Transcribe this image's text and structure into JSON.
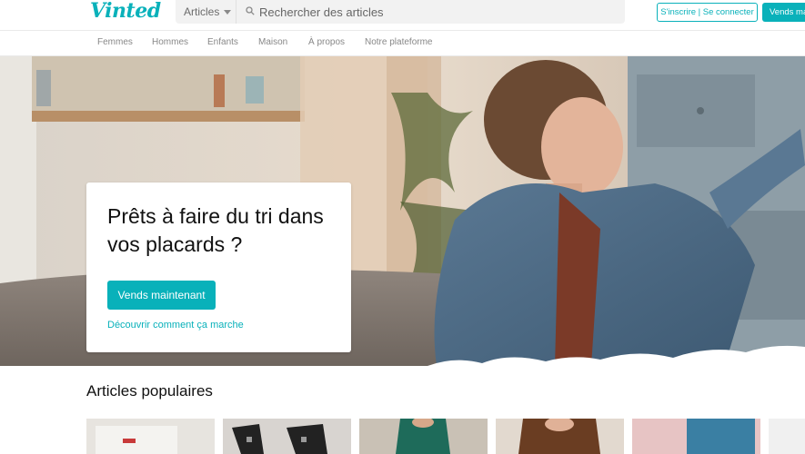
{
  "header": {
    "logo": "Vinted",
    "search_category": "Articles",
    "search_placeholder": "Rechercher des articles",
    "login_label": "S'inscrire | Se connecter",
    "sell_label": "Vends maintenant"
  },
  "nav": {
    "items": [
      "Femmes",
      "Hommes",
      "Enfants",
      "Maison",
      "À propos",
      "Notre plateforme"
    ]
  },
  "hero": {
    "title": "Prêts à faire du tri dans vos placards ?",
    "cta_label": "Vends maintenant",
    "link_label": "Découvrir comment ça marche"
  },
  "popular": {
    "title": "Articles populaires"
  },
  "colors": {
    "accent": "#09b1ba"
  },
  "icons": [
    "search-icon",
    "caret-down-icon"
  ]
}
